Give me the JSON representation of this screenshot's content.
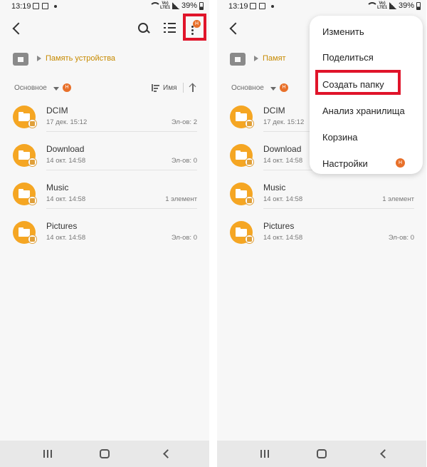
{
  "status": {
    "time": "13:19",
    "battery": "39%",
    "network_label": "Vo)\nLTE1"
  },
  "header": {
    "more_badge": "Н"
  },
  "breadcrumb": {
    "path": "Память устройства",
    "path_truncated": "Памят"
  },
  "sort": {
    "label": "Основное",
    "badge": "Н",
    "field": "Имя"
  },
  "files": [
    {
      "name": "DCIM",
      "date": "17 дек. 15:12",
      "count": "Эл-ов: 2",
      "icon": "folder-camera-icon"
    },
    {
      "name": "Download",
      "date": "14 окт. 14:58",
      "count": "Эл-ов: 0",
      "icon": "folder-download-icon"
    },
    {
      "name": "Music",
      "date": "14 окт. 14:58",
      "count": "1 элемент",
      "icon": "folder-music-icon"
    },
    {
      "name": "Pictures",
      "date": "14 окт. 14:58",
      "count": "Эл-ов: 0",
      "icon": "folder-image-icon"
    }
  ],
  "menu": {
    "items": [
      {
        "label": "Изменить"
      },
      {
        "label": "Поделиться"
      },
      {
        "label": "Создать папку"
      },
      {
        "label": "Анализ хранилища"
      },
      {
        "label": "Корзина"
      },
      {
        "label": "Настройки",
        "badge": "Н"
      }
    ]
  },
  "colors": {
    "accent": "#c78a00",
    "folder": "#f5a623",
    "badge": "#e8702a",
    "highlight": "#e0142a"
  }
}
